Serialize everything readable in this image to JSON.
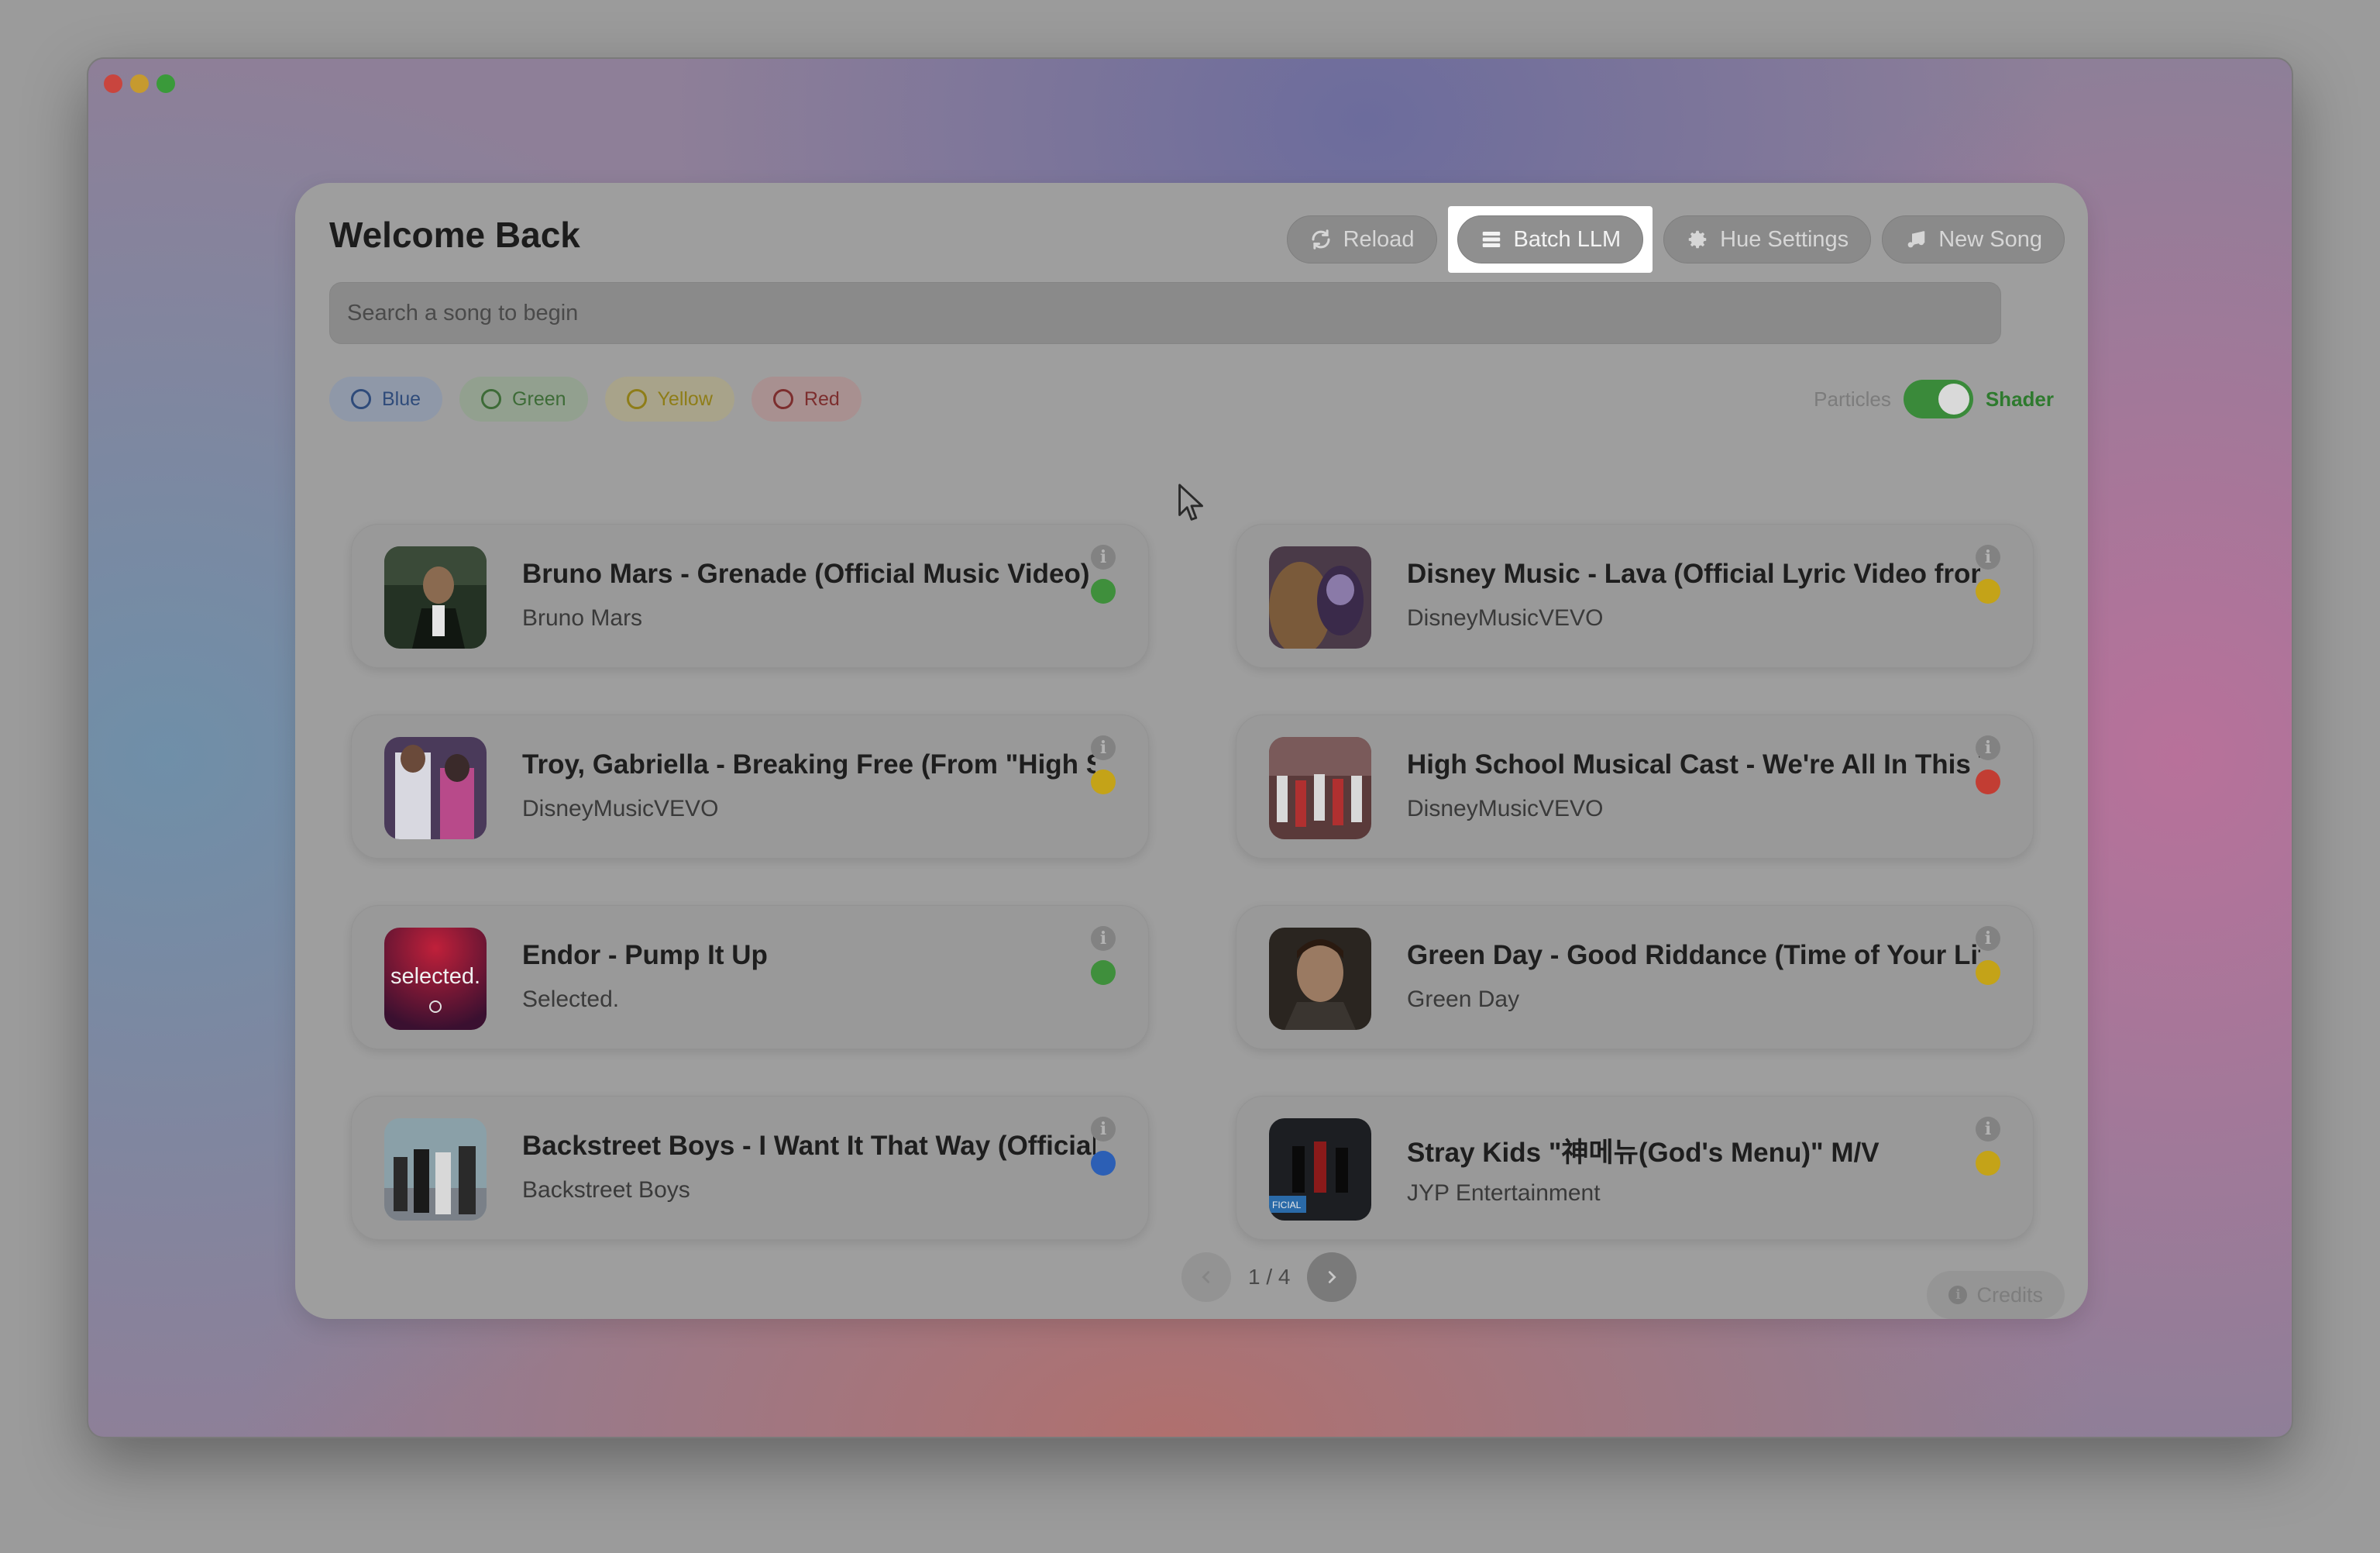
{
  "header": {
    "title": "Welcome Back"
  },
  "toolbar": {
    "reload_label": "Reload",
    "batch_llm_label": "Batch LLM",
    "hue_settings_label": "Hue Settings",
    "new_song_label": "New Song"
  },
  "search": {
    "placeholder": "Search a song to begin"
  },
  "filters": [
    {
      "label": "Blue"
    },
    {
      "label": "Green"
    },
    {
      "label": "Yellow"
    },
    {
      "label": "Red"
    }
  ],
  "mode_toggle": {
    "left_label": "Particles",
    "right_label": "Shader",
    "selected": "Shader"
  },
  "songs": [
    {
      "title": "Bruno Mars - Grenade (Official Music Video)",
      "artist": "Bruno Mars",
      "hue": "green"
    },
    {
      "title": "Disney Music - Lava (Official Lyric Video from Lava)",
      "artist": "DisneyMusicVEVO",
      "hue": "yellow"
    },
    {
      "title": "Troy, Gabriella - Breaking Free (From \"High School Musical\")",
      "artist": "DisneyMusicVEVO",
      "hue": "yellow"
    },
    {
      "title": "High School Musical Cast - We're All In This Together",
      "artist": "DisneyMusicVEVO",
      "hue": "red"
    },
    {
      "title": "Endor - Pump It Up",
      "artist": "Selected.",
      "hue": "green"
    },
    {
      "title": "Green Day - Good Riddance (Time of Your Life)",
      "artist": "Green Day",
      "hue": "yellow"
    },
    {
      "title": "Backstreet Boys - I Want It That Way (Official Music Video)",
      "artist": "Backstreet Boys",
      "hue": "blue"
    },
    {
      "title": "Stray Kids \"神메뉴(God's Menu)\" M/V",
      "artist": "JYP Entertainment",
      "hue": "yellow"
    }
  ],
  "pagination": {
    "text": "1 / 4"
  },
  "footer": {
    "credits_label": "Credits"
  },
  "colors": {
    "green": "#3f8f3c",
    "yellow": "#c4a318",
    "red": "#c23d33",
    "blue": "#2c5fb5",
    "toggle_on": "#3a8a3a"
  },
  "icons": {
    "reload": "refresh-icon",
    "batch_llm": "list-icon",
    "hue_settings": "gear-icon",
    "new_song": "music-note-icon",
    "info": "info-icon",
    "credits": "info-icon"
  }
}
